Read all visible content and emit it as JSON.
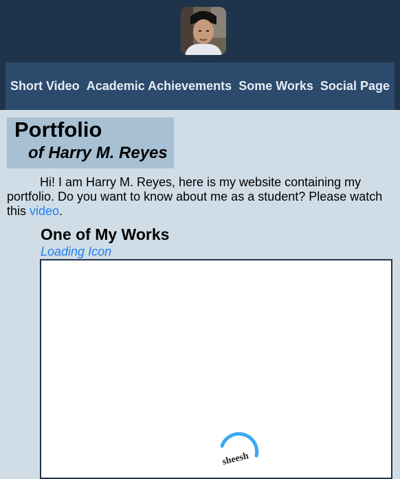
{
  "nav": {
    "items": [
      "Short Video",
      "Academic Achievements",
      "Some Works",
      "Social Page"
    ]
  },
  "title": {
    "main": "Portfolio",
    "sub": "of Harry M. Reyes"
  },
  "intro": {
    "text": "Hi! I am Harry M. Reyes, here is my website containing my portfolio. Do you want to know about me as a student? Please watch this ",
    "link": "video",
    "end": "."
  },
  "works": {
    "title": "One of My Works",
    "subtitle": "Loading Icon",
    "loader_text": "sheesh"
  },
  "colors": {
    "header_bg": "#1f344a",
    "nav_bg": "#2c4a6b",
    "page_bg": "#d1dde6",
    "title_box": "#a7c0d4",
    "link": "#1e7ff0",
    "spinner": "#3aa7f0"
  }
}
